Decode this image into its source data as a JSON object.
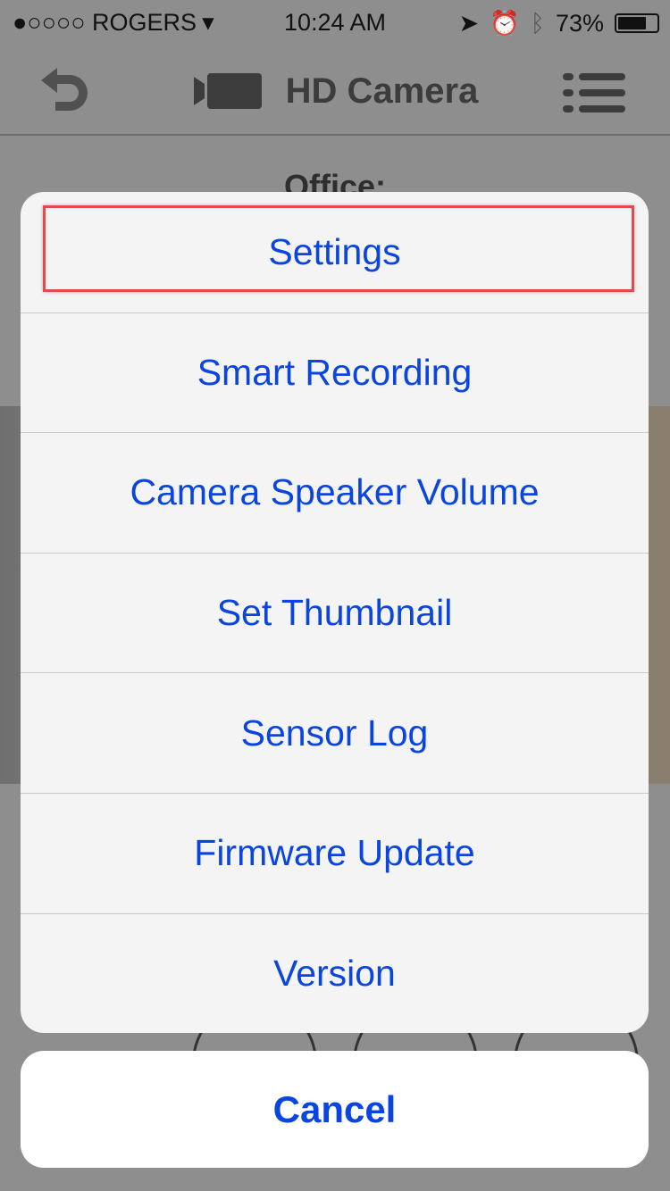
{
  "status_bar": {
    "carrier": "●○○○○ ROGERS",
    "time": "10:24 AM",
    "battery": "73%",
    "battery_level": 0.73
  },
  "nav": {
    "title": "HD Camera"
  },
  "page": {
    "location": "Office:"
  },
  "action_sheet": {
    "items": [
      {
        "label": "Settings",
        "highlighted": true
      },
      {
        "label": "Smart Recording"
      },
      {
        "label": "Camera Speaker Volume"
      },
      {
        "label": "Set Thumbnail"
      },
      {
        "label": "Sensor Log"
      },
      {
        "label": "Firmware Update"
      },
      {
        "label": "Version"
      }
    ],
    "cancel": "Cancel"
  },
  "colors": {
    "accent": "#0a45df",
    "highlight": "#e5484d"
  }
}
